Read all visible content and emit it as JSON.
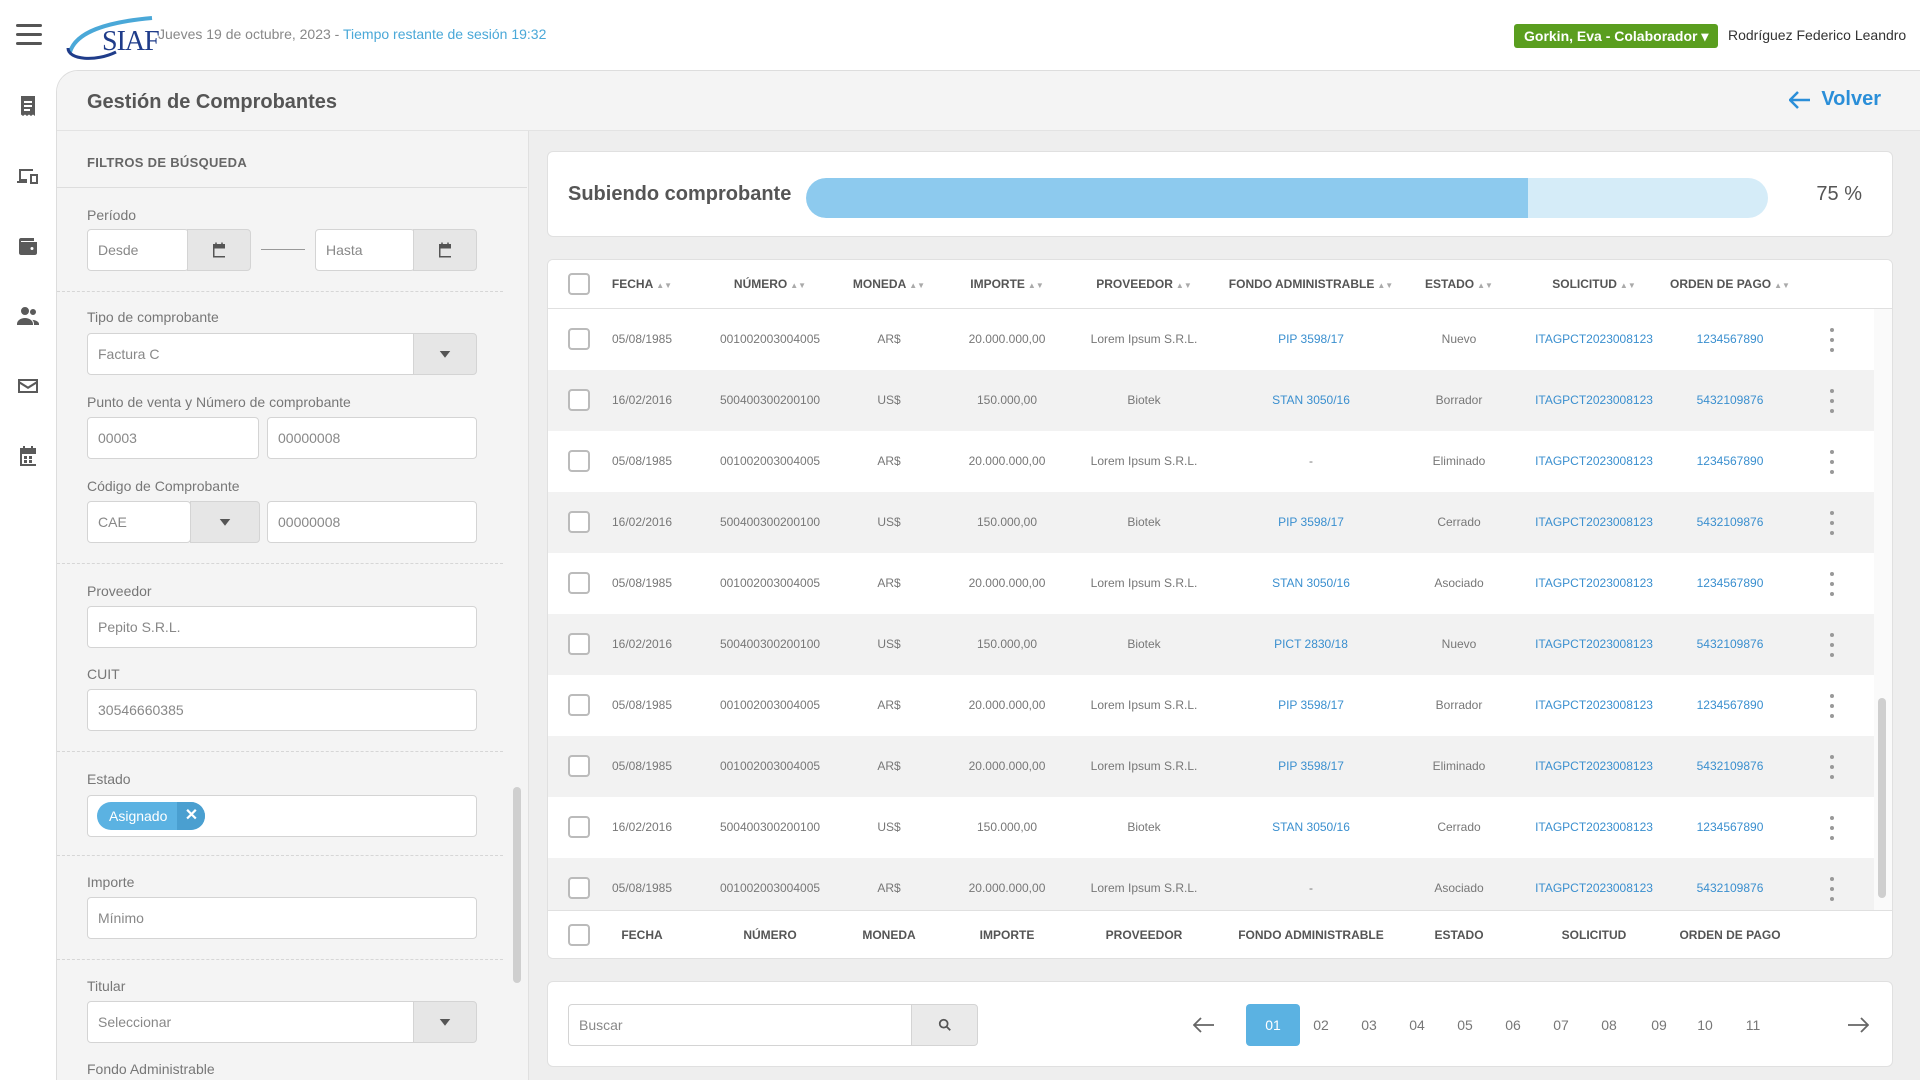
{
  "header": {
    "logo_text": "SIAF",
    "date": "Jueves 19 de octubre, 2023 - ",
    "session": "Tiempo restante de sesión 19:32",
    "user_badge": "Gorkin, Eva - Colaborador  ▾",
    "user_name": "Rodríguez Federico Leandro"
  },
  "page": {
    "title": "Gestión de Comprobantes",
    "back_label": "Volver"
  },
  "filters": {
    "title": "FILTROS DE BÚSQUEDA",
    "periodo_label": "Período",
    "desde_placeholder": "Desde",
    "hasta_placeholder": "Hasta",
    "tipo_label": "Tipo de comprobante",
    "tipo_value": "Factura C",
    "punto_label": "Punto de venta y Número de comprobante",
    "punto_value": "00003",
    "numero_value": "00000008",
    "codigo_label": "Código de Comprobante",
    "codigo_value": "CAE",
    "codigo_numero_value": "00000008",
    "proveedor_label": "Proveedor",
    "proveedor_value": "Pepito S.R.L.",
    "cuit_label": "CUIT",
    "cuit_value": "30546660385",
    "estado_label": "Estado",
    "estado_chip": "Asignado",
    "importe_label": "Importe",
    "importe_placeholder": "Mínimo",
    "titular_label": "Titular",
    "titular_value": "Seleccionar",
    "fondo_label": "Fondo Administrable"
  },
  "upload": {
    "label": "Subiendo comprobante",
    "progress": 0.75,
    "percent_text": "75 %"
  },
  "table": {
    "columns": [
      "FECHA",
      "NÚMERO",
      "MONEDA",
      "IMPORTE",
      "PROVEEDOR",
      "FONDO ADMINISTRABLE",
      "ESTADO",
      "SOLICITUD",
      "ORDEN DE PAGO"
    ],
    "rows": [
      {
        "fecha": "05/08/1985",
        "numero": "001002003004005",
        "moneda": "AR$",
        "importe": "20.000.000,00",
        "proveedor": "Lorem Ipsum S.R.L.",
        "fondo": "PIP 3598/17",
        "estado": "Nuevo",
        "solicitud": "ITAGPCT2023008123",
        "orden": "1234567890"
      },
      {
        "fecha": "16/02/2016",
        "numero": "500400300200100",
        "moneda": "US$",
        "importe": "150.000,00",
        "proveedor": "Biotek",
        "fondo": "STAN 3050/16",
        "estado": "Borrador",
        "solicitud": "ITAGPCT2023008123",
        "orden": "5432109876"
      },
      {
        "fecha": "05/08/1985",
        "numero": "001002003004005",
        "moneda": "AR$",
        "importe": "20.000.000,00",
        "proveedor": "Lorem Ipsum S.R.L.",
        "fondo": "-",
        "estado": "Eliminado",
        "solicitud": "ITAGPCT2023008123",
        "orden": "1234567890"
      },
      {
        "fecha": "16/02/2016",
        "numero": "500400300200100",
        "moneda": "US$",
        "importe": "150.000,00",
        "proveedor": "Biotek",
        "fondo": "PIP 3598/17",
        "estado": "Cerrado",
        "solicitud": "ITAGPCT2023008123",
        "orden": "5432109876"
      },
      {
        "fecha": "05/08/1985",
        "numero": "001002003004005",
        "moneda": "AR$",
        "importe": "20.000.000,00",
        "proveedor": "Lorem Ipsum S.R.L.",
        "fondo": "STAN 3050/16",
        "estado": "Asociado",
        "solicitud": "ITAGPCT2023008123",
        "orden": "1234567890"
      },
      {
        "fecha": "16/02/2016",
        "numero": "500400300200100",
        "moneda": "US$",
        "importe": "150.000,00",
        "proveedor": "Biotek",
        "fondo": "PICT 2830/18",
        "estado": "Nuevo",
        "solicitud": "ITAGPCT2023008123",
        "orden": "5432109876"
      },
      {
        "fecha": "05/08/1985",
        "numero": "001002003004005",
        "moneda": "AR$",
        "importe": "20.000.000,00",
        "proveedor": "Lorem Ipsum S.R.L.",
        "fondo": "PIP 3598/17",
        "estado": "Borrador",
        "solicitud": "ITAGPCT2023008123",
        "orden": "1234567890"
      },
      {
        "fecha": "05/08/1985",
        "numero": "001002003004005",
        "moneda": "AR$",
        "importe": "20.000.000,00",
        "proveedor": "Lorem Ipsum S.R.L.",
        "fondo": "PIP 3598/17",
        "estado": "Eliminado",
        "solicitud": "ITAGPCT2023008123",
        "orden": "5432109876"
      },
      {
        "fecha": "16/02/2016",
        "numero": "500400300200100",
        "moneda": "US$",
        "importe": "150.000,00",
        "proveedor": "Biotek",
        "fondo": "STAN 3050/16",
        "estado": "Cerrado",
        "solicitud": "ITAGPCT2023008123",
        "orden": "1234567890"
      },
      {
        "fecha": "05/08/1985",
        "numero": "001002003004005",
        "moneda": "AR$",
        "importe": "20.000.000,00",
        "proveedor": "Lorem Ipsum S.R.L.",
        "fondo": "-",
        "estado": "Asociado",
        "solicitud": "ITAGPCT2023008123",
        "orden": "5432109876"
      }
    ]
  },
  "pager": {
    "search_placeholder": "Buscar",
    "pages": [
      "01",
      "02",
      "03",
      "04",
      "05",
      "06",
      "07",
      "08",
      "09",
      "10",
      "11"
    ],
    "active_page": "01"
  },
  "colors": {
    "accent": "#5bb2e2",
    "link": "#3a8fcf",
    "badge": "#5a9e1f"
  }
}
